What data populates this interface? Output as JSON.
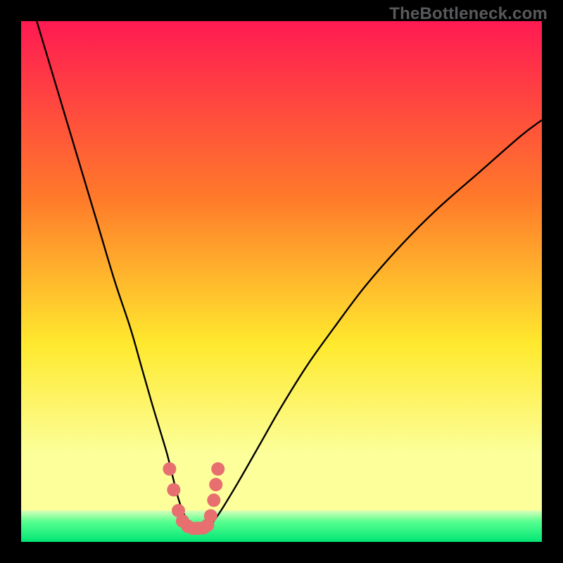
{
  "watermark": "TheBottleneck.com",
  "colors": {
    "bg": "#000000",
    "grad_top": "#ff1a52",
    "grad_mid1": "#ff7a2a",
    "grad_mid2": "#ffe92e",
    "grad_low": "#fcff9a",
    "grad_green1": "#57ff8f",
    "grad_green2": "#00e676",
    "curve": "#000000",
    "dots": "#e76f6f"
  },
  "chart_data": {
    "type": "line",
    "title": "",
    "xlabel": "",
    "ylabel": "",
    "xlim": [
      0,
      100
    ],
    "ylim": [
      0,
      100
    ],
    "series": [
      {
        "name": "curve",
        "x": [
          3,
          6,
          9,
          12,
          15,
          18,
          21,
          23,
          25,
          26.5,
          28,
          29,
          30,
          31,
          32,
          33,
          34,
          35,
          36,
          37,
          39,
          42,
          46,
          50,
          55,
          60,
          66,
          73,
          80,
          88,
          96,
          100
        ],
        "y": [
          100,
          90,
          80,
          70,
          60,
          50,
          41,
          34,
          27,
          22,
          17,
          13,
          9,
          6,
          4,
          3,
          2.5,
          2.5,
          3,
          4,
          7,
          12,
          19,
          26,
          34,
          41,
          49,
          57,
          64,
          71,
          78,
          81
        ]
      }
    ],
    "markers": [
      {
        "x": 28.5,
        "y": 14
      },
      {
        "x": 29.3,
        "y": 10
      },
      {
        "x": 30.2,
        "y": 6
      },
      {
        "x": 31.0,
        "y": 4
      },
      {
        "x": 32.0,
        "y": 3
      },
      {
        "x": 33.0,
        "y": 2.6
      },
      {
        "x": 34.0,
        "y": 2.6
      },
      {
        "x": 35.0,
        "y": 2.7
      },
      {
        "x": 35.8,
        "y": 3.2
      },
      {
        "x": 36.4,
        "y": 5
      },
      {
        "x": 37.0,
        "y": 8
      },
      {
        "x": 37.4,
        "y": 11
      },
      {
        "x": 37.8,
        "y": 14
      }
    ],
    "green_band": {
      "y0": 0,
      "y1": 6
    }
  }
}
